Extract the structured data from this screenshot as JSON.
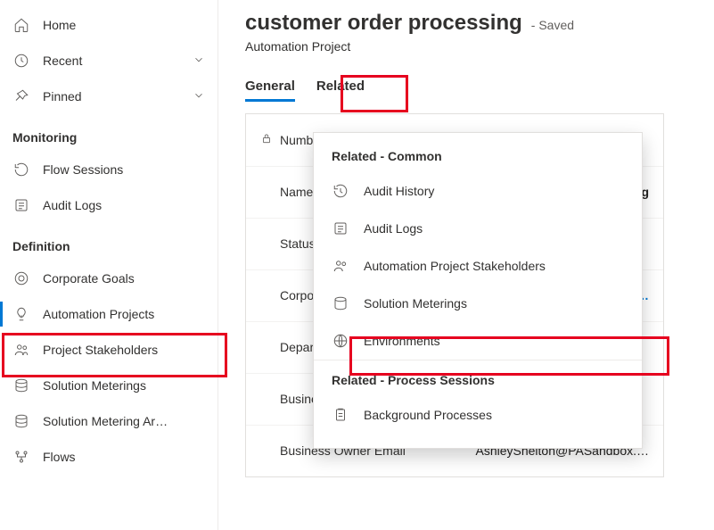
{
  "sidebar": {
    "top": [
      {
        "name": "home",
        "label": "Home"
      },
      {
        "name": "recent",
        "label": "Recent",
        "chevron": true
      },
      {
        "name": "pinned",
        "label": "Pinned",
        "chevron": true
      }
    ],
    "sections": [
      {
        "title": "Monitoring",
        "items": [
          {
            "name": "flow-sessions",
            "label": "Flow Sessions"
          },
          {
            "name": "audit-logs",
            "label": "Audit Logs"
          }
        ]
      },
      {
        "title": "Definition",
        "items": [
          {
            "name": "corporate-goals",
            "label": "Corporate Goals"
          },
          {
            "name": "automation-projects",
            "label": "Automation Projects",
            "active": true
          },
          {
            "name": "project-stakeholders",
            "label": "Project Stakeholders"
          },
          {
            "name": "solution-meterings",
            "label": "Solution Meterings"
          },
          {
            "name": "solution-metering-ar",
            "label": "Solution Metering Ar…"
          },
          {
            "name": "flows",
            "label": "Flows"
          }
        ]
      }
    ]
  },
  "header": {
    "title": "customer order processing",
    "saved": "- Saved",
    "subtitle": "Automation Project"
  },
  "tabs": [
    {
      "label": "General",
      "active": true
    },
    {
      "label": "Related"
    }
  ],
  "form": {
    "rows": [
      {
        "label": "Number",
        "locked": true,
        "value": ""
      },
      {
        "label": "Name",
        "value": "ing",
        "bold": true
      },
      {
        "label": "Status",
        "value": ""
      },
      {
        "label": "Corporate",
        "value": "h Aut…",
        "link": true
      },
      {
        "label": "Department",
        "value": ""
      },
      {
        "label": "Business",
        "value": ""
      },
      {
        "label": "Business Owner Email",
        "value": "AshleyShelton@PASandbox.…"
      }
    ]
  },
  "menu": {
    "groups": [
      {
        "title": "Related - Common",
        "items": [
          {
            "name": "audit-history",
            "label": "Audit History"
          },
          {
            "name": "audit-logs",
            "label": "Audit Logs"
          },
          {
            "name": "stakeholders",
            "label": "Automation Project Stakeholders"
          },
          {
            "name": "solution-meterings",
            "label": "Solution Meterings"
          },
          {
            "name": "environments",
            "label": "Environments"
          }
        ]
      },
      {
        "title": "Related - Process Sessions",
        "items": [
          {
            "name": "background-processes",
            "label": "Background Processes"
          }
        ]
      }
    ]
  }
}
